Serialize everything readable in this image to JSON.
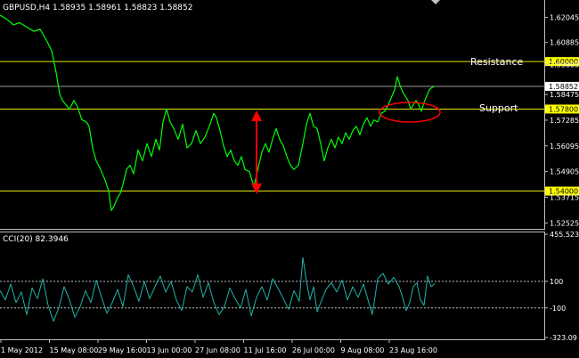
{
  "header": {
    "main_title": "GBPUSD,H4  1.58935 1.58961 1.58823 1.58852",
    "cci_title": "CCI(20) 82.3946"
  },
  "annotations": {
    "resistance": "Resistance",
    "support": "Support"
  },
  "colors": {
    "background": "#000000",
    "price_line": "#00ff00",
    "cci_line": "#20b2aa",
    "level_line": "#e6e600",
    "level_label_bg": "#ffff00",
    "axis": "#c0c0c0",
    "current_price_bg": "#ffffff",
    "arrow": "#ff0000",
    "ellipse": "#ff0000"
  },
  "chart_data": [
    {
      "type": "line",
      "title": "GBPUSD,H4  1.58935 1.58961 1.58823 1.58852",
      "ylim": [
        1.5229,
        1.6277
      ],
      "y_ticks": [
        "1.62045",
        "1.60885",
        "1.59865",
        "1.58475",
        "1.57285",
        "1.56095",
        "1.54905",
        "1.53715",
        "1.52525"
      ],
      "horizontal_levels": [
        {
          "label": "1.60000",
          "value": 1.6
        },
        {
          "label": "1.57800",
          "value": 1.578
        },
        {
          "label": "1.54000",
          "value": 1.54
        }
      ],
      "current_price": {
        "label": "1.58852",
        "value": 1.58852
      },
      "x_ticks": [
        "1 May 2012",
        "15 May 08:00",
        "29 May 16:00",
        "13 Jun 00:00",
        "27 Jun 08:00",
        "11 Jul 16:00",
        "26 Jul 00:00",
        "9 Aug 08:00",
        "23 Aug 16:00"
      ],
      "approx_anchor_points": [
        [
          0,
          1.6215
        ],
        [
          8,
          1.6195
        ],
        [
          15,
          1.617
        ],
        [
          22,
          1.618
        ],
        [
          30,
          1.616
        ],
        [
          38,
          1.614
        ],
        [
          45,
          1.615
        ],
        [
          52,
          1.61
        ],
        [
          58,
          1.605
        ],
        [
          63,
          1.595
        ],
        [
          67,
          1.585
        ],
        [
          70,
          1.582
        ],
        [
          74,
          1.58
        ],
        [
          78,
          1.578
        ],
        [
          83,
          1.582
        ],
        [
          87,
          1.579
        ],
        [
          92,
          1.573
        ],
        [
          97,
          1.572
        ],
        [
          100,
          1.57
        ],
        [
          104,
          1.56
        ],
        [
          108,
          1.554
        ],
        [
          113,
          1.55
        ],
        [
          118,
          1.545
        ],
        [
          122,
          1.54
        ],
        [
          125,
          1.531
        ],
        [
          128,
          1.533
        ],
        [
          132,
          1.537
        ],
        [
          135,
          1.539
        ],
        [
          138,
          1.543
        ],
        [
          142,
          1.55
        ],
        [
          146,
          1.552
        ],
        [
          150,
          1.548
        ],
        [
          155,
          1.559
        ],
        [
          160,
          1.554
        ],
        [
          165,
          1.562
        ],
        [
          170,
          1.556
        ],
        [
          175,
          1.564
        ],
        [
          179,
          1.559
        ],
        [
          183,
          1.572
        ],
        [
          187,
          1.578
        ],
        [
          191,
          1.572
        ],
        [
          195,
          1.569
        ],
        [
          200,
          1.564
        ],
        [
          205,
          1.571
        ],
        [
          210,
          1.56
        ],
        [
          215,
          1.562
        ],
        [
          220,
          1.568
        ],
        [
          225,
          1.562
        ],
        [
          230,
          1.565
        ],
        [
          235,
          1.57
        ],
        [
          240,
          1.576
        ],
        [
          243,
          1.574
        ],
        [
          247,
          1.568
        ],
        [
          251,
          1.561
        ],
        [
          255,
          1.556
        ],
        [
          259,
          1.559
        ],
        [
          263,
          1.554
        ],
        [
          267,
          1.552
        ],
        [
          271,
          1.556
        ],
        [
          275,
          1.55
        ],
        [
          280,
          1.549
        ],
        [
          285,
          1.542
        ],
        [
          290,
          1.551
        ],
        [
          294,
          1.558
        ],
        [
          298,
          1.562
        ],
        [
          302,
          1.558
        ],
        [
          306,
          1.564
        ],
        [
          310,
          1.569
        ],
        [
          314,
          1.564
        ],
        [
          318,
          1.561
        ],
        [
          322,
          1.556
        ],
        [
          326,
          1.552
        ],
        [
          330,
          1.55
        ],
        [
          335,
          1.552
        ],
        [
          340,
          1.562
        ],
        [
          344,
          1.571
        ],
        [
          348,
          1.576
        ],
        [
          352,
          1.57
        ],
        [
          356,
          1.569
        ],
        [
          360,
          1.562
        ],
        [
          364,
          1.554
        ],
        [
          368,
          1.56
        ],
        [
          372,
          1.564
        ],
        [
          376,
          1.56
        ],
        [
          380,
          1.565
        ],
        [
          384,
          1.562
        ],
        [
          388,
          1.567
        ],
        [
          392,
          1.564
        ],
        [
          396,
          1.568
        ],
        [
          400,
          1.57
        ],
        [
          404,
          1.566
        ],
        [
          408,
          1.571
        ],
        [
          412,
          1.574
        ],
        [
          416,
          1.57
        ],
        [
          420,
          1.573
        ],
        [
          424,
          1.572
        ],
        [
          428,
          1.576
        ],
        [
          432,
          1.577
        ],
        [
          436,
          1.58
        ],
        [
          440,
          1.584
        ],
        [
          443,
          1.587
        ],
        [
          446,
          1.593
        ],
        [
          449,
          1.589
        ],
        [
          452,
          1.586
        ],
        [
          455,
          1.584
        ],
        [
          458,
          1.582
        ],
        [
          461,
          1.578
        ],
        [
          464,
          1.58
        ],
        [
          467,
          1.582
        ],
        [
          470,
          1.58
        ],
        [
          473,
          1.577
        ],
        [
          476,
          1.581
        ],
        [
          479,
          1.584
        ],
        [
          482,
          1.587
        ],
        [
          485,
          1.588
        ],
        [
          488,
          1.5885
        ]
      ]
    },
    {
      "type": "line",
      "title": "CCI(20) 82.3946",
      "ylim": [
        -323.09,
        455.5233
      ],
      "y_ticks": [
        "455.5233",
        "100",
        "-100",
        "-323.09"
      ],
      "horizontal_levels": [
        {
          "label": "100",
          "value": 100
        },
        {
          "label": "-100",
          "value": -100
        }
      ],
      "approx_anchor_points": [
        [
          0,
          30
        ],
        [
          6,
          -40
        ],
        [
          12,
          80
        ],
        [
          18,
          -60
        ],
        [
          24,
          20
        ],
        [
          30,
          -150
        ],
        [
          36,
          50
        ],
        [
          42,
          -30
        ],
        [
          48,
          120
        ],
        [
          54,
          -80
        ],
        [
          60,
          -200
        ],
        [
          66,
          -100
        ],
        [
          72,
          60
        ],
        [
          78,
          -40
        ],
        [
          84,
          -170
        ],
        [
          90,
          -90
        ],
        [
          96,
          30
        ],
        [
          102,
          -60
        ],
        [
          108,
          110
        ],
        [
          114,
          -20
        ],
        [
          120,
          -140
        ],
        [
          126,
          -60
        ],
        [
          132,
          40
        ],
        [
          138,
          -90
        ],
        [
          144,
          150
        ],
        [
          150,
          60
        ],
        [
          156,
          -50
        ],
        [
          162,
          100
        ],
        [
          168,
          -30
        ],
        [
          174,
          60
        ],
        [
          180,
          140
        ],
        [
          186,
          20
        ],
        [
          192,
          100
        ],
        [
          198,
          -40
        ],
        [
          204,
          -120
        ],
        [
          210,
          60
        ],
        [
          216,
          20
        ],
        [
          222,
          150
        ],
        [
          228,
          -20
        ],
        [
          234,
          90
        ],
        [
          240,
          -60
        ],
        [
          246,
          -150
        ],
        [
          252,
          -90
        ],
        [
          258,
          50
        ],
        [
          264,
          -30
        ],
        [
          270,
          -100
        ],
        [
          276,
          40
        ],
        [
          282,
          -160
        ],
        [
          288,
          -20
        ],
        [
          294,
          60
        ],
        [
          300,
          -40
        ],
        [
          306,
          120
        ],
        [
          312,
          50
        ],
        [
          318,
          -30
        ],
        [
          324,
          -110
        ],
        [
          330,
          30
        ],
        [
          336,
          -50
        ],
        [
          340,
          280
        ],
        [
          344,
          100
        ],
        [
          348,
          -40
        ],
        [
          352,
          60
        ],
        [
          356,
          -130
        ],
        [
          360,
          -60
        ],
        [
          366,
          40
        ],
        [
          372,
          90
        ],
        [
          378,
          20
        ],
        [
          384,
          110
        ],
        [
          390,
          -40
        ],
        [
          396,
          60
        ],
        [
          402,
          -20
        ],
        [
          408,
          80
        ],
        [
          414,
          -60
        ],
        [
          418,
          -150
        ],
        [
          424,
          120
        ],
        [
          430,
          160
        ],
        [
          436,
          80
        ],
        [
          442,
          130
        ],
        [
          448,
          60
        ],
        [
          452,
          -20
        ],
        [
          456,
          -120
        ],
        [
          460,
          -60
        ],
        [
          464,
          60
        ],
        [
          468,
          90
        ],
        [
          472,
          -40
        ],
        [
          476,
          -80
        ],
        [
          480,
          140
        ],
        [
          484,
          60
        ],
        [
          488,
          82
        ]
      ]
    }
  ]
}
